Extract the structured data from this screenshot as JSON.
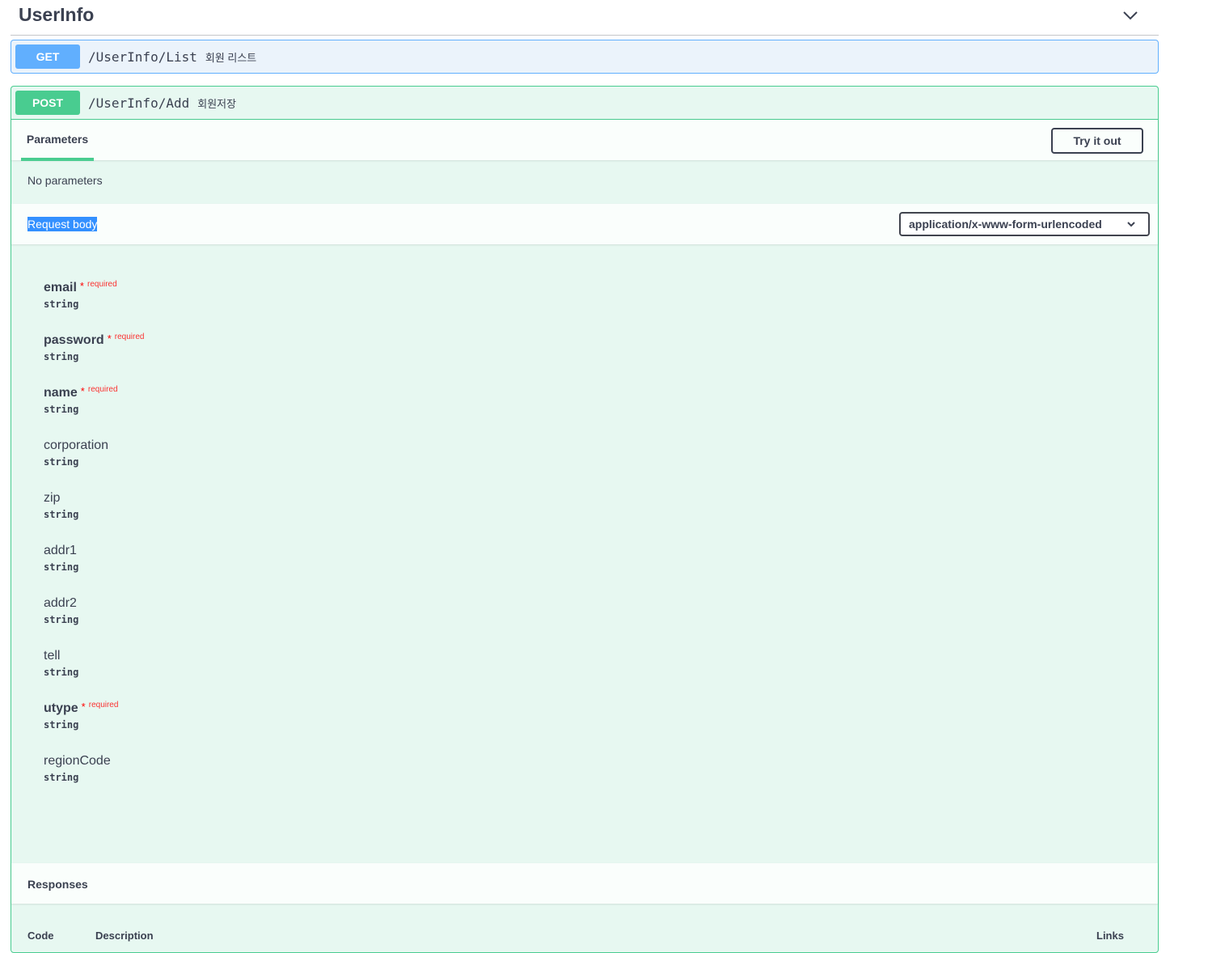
{
  "tag": {
    "title": "UserInfo",
    "toggle_icon": "chevron-down-icon"
  },
  "get_op": {
    "method": "GET",
    "path": "/UserInfo/List",
    "summary": "회원 리스트"
  },
  "post_op": {
    "method": "POST",
    "path": "/UserInfo/Add",
    "summary": "회원저장",
    "parameters_tab": "Parameters",
    "try_button": "Try it out",
    "no_params": "No parameters",
    "request_body_title": "Request body",
    "content_type": "application/x-www-form-urlencoded",
    "fields": [
      {
        "name": "email",
        "type": "string",
        "required": true,
        "star": "*",
        "req_label": "required"
      },
      {
        "name": "password",
        "type": "string",
        "required": true,
        "star": "*",
        "req_label": "required"
      },
      {
        "name": "name",
        "type": "string",
        "required": true,
        "star": "*",
        "req_label": "required"
      },
      {
        "name": "corporation",
        "type": "string",
        "required": false
      },
      {
        "name": "zip",
        "type": "string",
        "required": false
      },
      {
        "name": "addr1",
        "type": "string",
        "required": false
      },
      {
        "name": "addr2",
        "type": "string",
        "required": false
      },
      {
        "name": "tell",
        "type": "string",
        "required": false
      },
      {
        "name": "utype",
        "type": "string",
        "required": true,
        "star": "*",
        "req_label": "required"
      },
      {
        "name": "regionCode",
        "type": "string",
        "required": false
      }
    ],
    "responses_title": "Responses",
    "response_columns": [
      "Code",
      "Description",
      "Links"
    ]
  }
}
